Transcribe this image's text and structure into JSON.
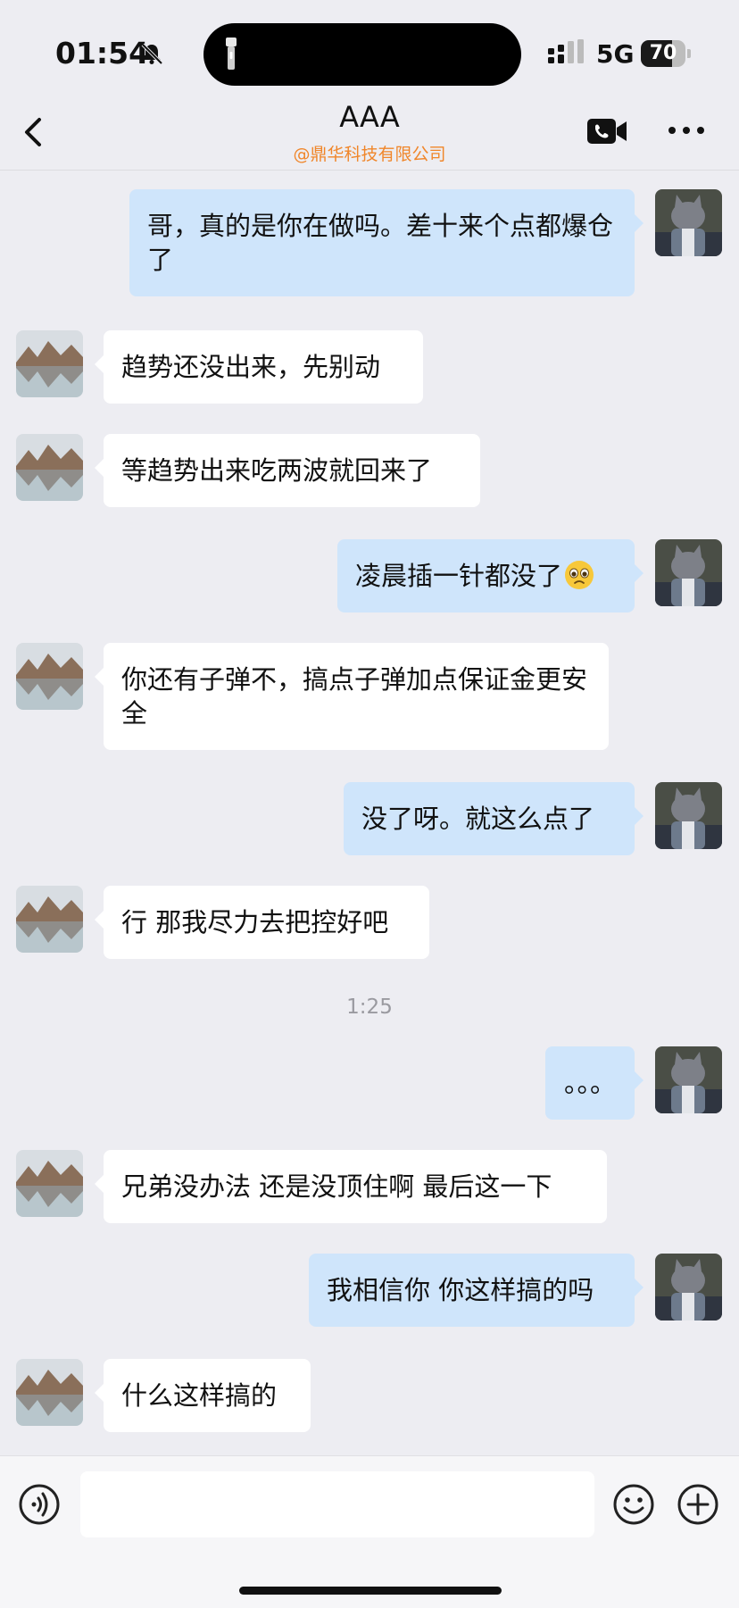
{
  "status_bar": {
    "time": "01:54",
    "network": "5G",
    "battery": "70",
    "battery_level": 0.7
  },
  "header": {
    "title": "AAA",
    "subtitle": "@鼎华科技有限公司"
  },
  "messages": [
    {
      "side": "out",
      "text": "哥，真的是你在做吗。差十来个点都爆仓了"
    },
    {
      "side": "in",
      "text": "趋势还没出来，先别动"
    },
    {
      "side": "in",
      "text": "等趋势出来吃两波就回来了"
    },
    {
      "side": "out",
      "text": "凌晨插一针都没了",
      "emoji": "pleading-face-icon"
    },
    {
      "side": "in",
      "text": "你还有子弹不，搞点子弹加点保证金更安全"
    },
    {
      "side": "out",
      "text": "没了呀。就这么点了"
    },
    {
      "side": "in",
      "text": "行 那我尽力去把控好吧"
    },
    {
      "type": "timestamp",
      "text": "1:25"
    },
    {
      "side": "out",
      "text": "。。。"
    },
    {
      "side": "in",
      "text": "兄弟没办法 还是没顶住啊 最后这一下"
    },
    {
      "side": "out",
      "text": "我相信你 你这样搞的吗"
    },
    {
      "side": "in",
      "text": "什么这样搞的"
    }
  ],
  "input": {
    "value": "",
    "placeholder": ""
  },
  "colors": {
    "background": "#ededf2",
    "incoming_bubble": "#ffffff",
    "outgoing_bubble": "#cfe5fb",
    "subtitle": "#f0862a"
  }
}
